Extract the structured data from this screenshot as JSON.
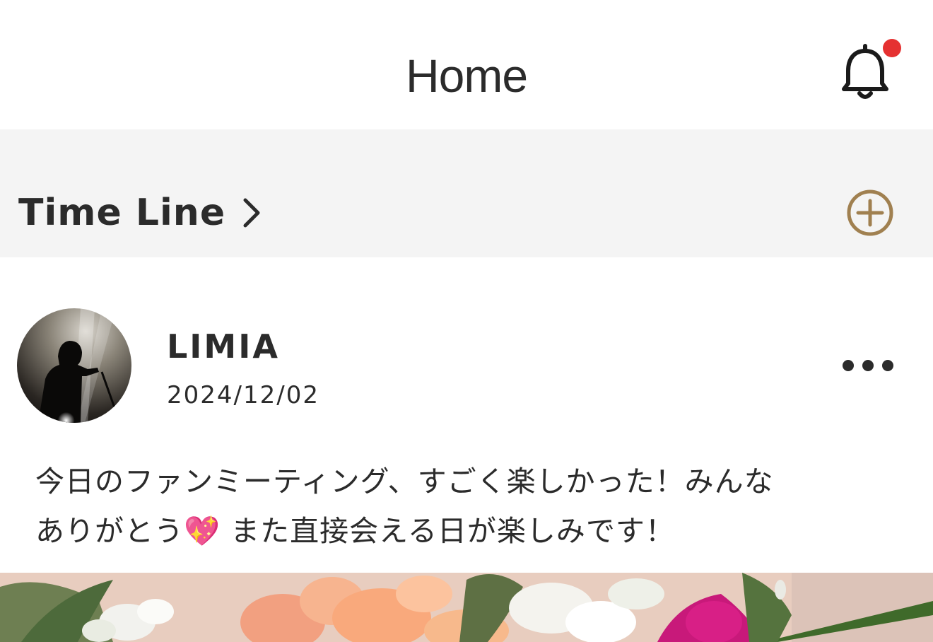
{
  "header": {
    "title": "Home",
    "notification_icon": "bell-icon",
    "notification_dot_color": "#e53131"
  },
  "timeline": {
    "label": "Time Line",
    "chevron_icon": "chevron-right-icon",
    "add_icon": "plus-circle-icon",
    "accent_color": "#a08050"
  },
  "post": {
    "author": "LIMIA",
    "date": "2024/12/02",
    "more_icon": "ellipsis-icon",
    "text_line1": "今日のファンミーティング、すごく楽しかった！みんな",
    "text_line2": "ありがとう💖 また直接会える日が楽しみです！"
  }
}
